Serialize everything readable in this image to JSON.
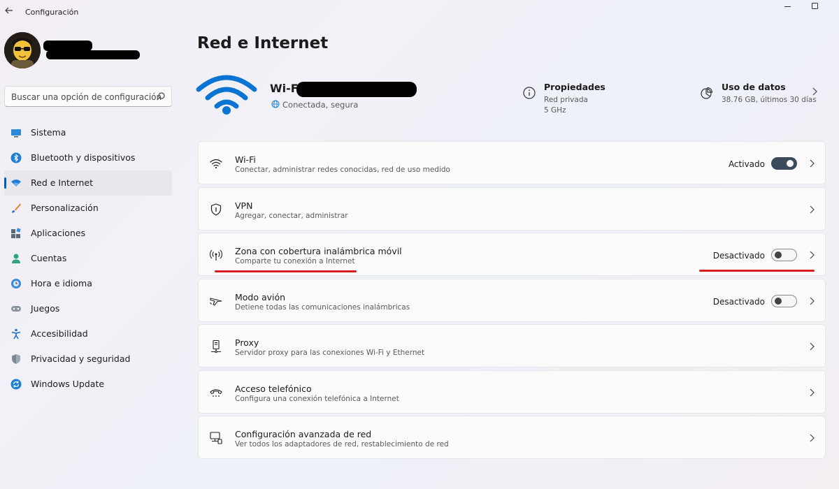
{
  "window": {
    "title": "Configuración"
  },
  "sidebar": {
    "search_placeholder": "Buscar una opción de configuración",
    "items": [
      {
        "label": "Sistema",
        "icon": "monitor-icon"
      },
      {
        "label": "Bluetooth y dispositivos",
        "icon": "bluetooth-icon"
      },
      {
        "label": "Red e Internet",
        "icon": "wifi-icon",
        "active": true
      },
      {
        "label": "Personalización",
        "icon": "brush-icon"
      },
      {
        "label": "Aplicaciones",
        "icon": "apps-icon"
      },
      {
        "label": "Cuentas",
        "icon": "person-icon"
      },
      {
        "label": "Hora e idioma",
        "icon": "globe-clock-icon"
      },
      {
        "label": "Juegos",
        "icon": "gamepad-icon"
      },
      {
        "label": "Accesibilidad",
        "icon": "accessibility-icon"
      },
      {
        "label": "Privacidad y seguridad",
        "icon": "shield-icon"
      },
      {
        "label": "Windows Update",
        "icon": "update-icon"
      }
    ]
  },
  "main": {
    "title": "Red e Internet",
    "connection": {
      "name": "Wi-Fi",
      "status": "Conectada, segura"
    },
    "properties": {
      "title": "Propiedades",
      "line1": "Red privada",
      "line2": "5 GHz"
    },
    "data_usage": {
      "title": "Uso de datos",
      "sub": "38.76 GB, últimos 30 días"
    },
    "cards": [
      {
        "title": "Wi-Fi",
        "sub": "Conectar, administrar redes conocidas, red de uso medido",
        "state": "Activado",
        "toggle": "on",
        "icon": "wifi-icon"
      },
      {
        "title": "VPN",
        "sub": "Agregar, conectar, administrar",
        "state": "",
        "toggle": "none",
        "icon": "shield-icon"
      },
      {
        "title": "Zona con cobertura inalámbrica móvil",
        "sub": "Comparte tu conexión a Internet",
        "state": "Desactivado",
        "toggle": "off",
        "icon": "hotspot-icon"
      },
      {
        "title": "Modo avión",
        "sub": "Detiene todas las comunicaciones inalámbricas",
        "state": "Desactivado",
        "toggle": "off",
        "icon": "airplane-icon"
      },
      {
        "title": "Proxy",
        "sub": "Servidor proxy para las conexiones Wi-Fi y Ethernet",
        "state": "",
        "toggle": "none",
        "icon": "proxy-icon"
      },
      {
        "title": "Acceso telefónico",
        "sub": "Configura una conexión telefónica a Internet",
        "state": "",
        "toggle": "none",
        "icon": "phone-icon"
      },
      {
        "title": "Configuración avanzada de red",
        "sub": "Ver todos los adaptadores de red, restablecimiento de red",
        "state": "",
        "toggle": "none",
        "icon": "network-adapter-icon"
      }
    ]
  },
  "colors": {
    "accent": "#005fb8",
    "wifi_blue": "#0a74d4",
    "annotation_red": "#d81c22"
  }
}
